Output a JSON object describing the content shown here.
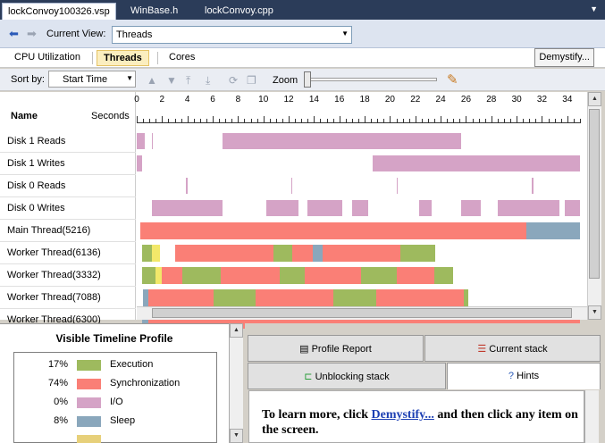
{
  "doc_tabs": [
    "lockConvoy100326.vsp",
    "WinBase.h",
    "lockConvoy.cpp"
  ],
  "current_view": {
    "label": "Current View:",
    "value": "Threads"
  },
  "view_tabs": [
    "CPU Utilization",
    "Threads",
    "Cores"
  ],
  "demystify_label": "Demystify...",
  "toolbar": {
    "sort_label": "Sort by:",
    "sort_value": "Start Time",
    "zoom_label": "Zoom"
  },
  "header": {
    "name": "Name",
    "seconds": "Seconds"
  },
  "ruler_max_seconds": 35,
  "ruler_labels": [
    "0",
    "2",
    "4",
    "6",
    "8",
    "10",
    "12",
    "14",
    "16",
    "18",
    "20",
    "22",
    "24",
    "26",
    "28",
    "30",
    "32",
    "34"
  ],
  "colors": {
    "execution": "#9eba5e",
    "synchronization": "#fa7f76",
    "io": "#d5a3c6",
    "sleep": "#8aa7bc",
    "other": "#f2e86a"
  },
  "rows": [
    {
      "name": "Disk 1 Reads",
      "kind": "io",
      "segments": [
        [
          0,
          0.6
        ],
        [
          1.2,
          1.3
        ],
        [
          6.8,
          25.6
        ]
      ]
    },
    {
      "name": "Disk 1 Writes",
      "kind": "io",
      "segments": [
        [
          0,
          0.4
        ],
        [
          18.6,
          35
        ]
      ]
    },
    {
      "name": "Disk 0 Reads",
      "kind": "io",
      "segments": [
        [
          3.9,
          4.0
        ],
        [
          12.2,
          12.3
        ],
        [
          20.5,
          20.6
        ],
        [
          31.2,
          31.3
        ]
      ]
    },
    {
      "name": "Disk 0 Writes",
      "kind": "io",
      "segments": [
        [
          1.2,
          6.8
        ],
        [
          10.2,
          12.8
        ],
        [
          13.5,
          16.2
        ],
        [
          17.0,
          18.3
        ],
        [
          22.3,
          23.3
        ],
        [
          25.6,
          27.2
        ],
        [
          28.5,
          33.4
        ],
        [
          33.8,
          35
        ]
      ]
    },
    {
      "name": "Main Thread(5216)",
      "kind": "main",
      "segments": [
        [
          "sync",
          0.3,
          30.8
        ],
        [
          "sleep",
          30.8,
          35
        ]
      ]
    },
    {
      "name": "Worker Thread(6136)",
      "kind": "worker",
      "segments": [
        [
          "exec",
          0.4,
          1.2
        ],
        [
          "other",
          1.2,
          1.8
        ],
        [
          "sync",
          3.0,
          10.8
        ],
        [
          "exec",
          10.8,
          12.3
        ],
        [
          "sync",
          12.3,
          13.9
        ],
        [
          "sleep",
          13.9,
          14.7
        ],
        [
          "sync",
          14.7,
          20.8
        ],
        [
          "exec",
          20.8,
          23.6
        ]
      ]
    },
    {
      "name": "Worker Thread(3332)",
      "kind": "worker",
      "segments": [
        [
          "exec",
          0.4,
          1.5
        ],
        [
          "other",
          1.5,
          2.0
        ],
        [
          "sync",
          2.0,
          3.6
        ],
        [
          "exec",
          3.6,
          6.6
        ],
        [
          "sync",
          6.6,
          11.3
        ],
        [
          "exec",
          11.3,
          13.3
        ],
        [
          "sync",
          13.3,
          17.7
        ],
        [
          "exec",
          17.7,
          20.5
        ],
        [
          "sync",
          20.5,
          23.5
        ],
        [
          "exec",
          23.5,
          25.0
        ]
      ]
    },
    {
      "name": "Worker Thread(7088)",
      "kind": "worker",
      "segments": [
        [
          "sleep",
          0.5,
          0.9
        ],
        [
          "sync",
          0.9,
          6.1
        ],
        [
          "exec",
          6.1,
          9.4
        ],
        [
          "sync",
          9.4,
          15.5
        ],
        [
          "exec",
          15.5,
          18.9
        ],
        [
          "sync",
          18.9,
          25.8
        ],
        [
          "exec",
          25.8,
          26.2
        ]
      ]
    },
    {
      "name": "Worker Thread(6300)",
      "kind": "worker",
      "segments": [
        [
          "sleep",
          0.4,
          0.9
        ],
        [
          "sync",
          0.9,
          35
        ]
      ]
    }
  ],
  "profile": {
    "title": "Visible Timeline Profile",
    "items": [
      {
        "pct": "17%",
        "name": "Execution",
        "color": "#9eba5e"
      },
      {
        "pct": "74%",
        "name": "Synchronization",
        "color": "#fa7f76"
      },
      {
        "pct": "0%",
        "name": "I/O",
        "color": "#d5a3c6"
      },
      {
        "pct": "8%",
        "name": "Sleep",
        "color": "#8aa7bc"
      },
      {
        "pct": "",
        "name": "",
        "color": "#e7d07a"
      }
    ]
  },
  "report_tabs": {
    "profile_report": "Profile Report",
    "current_stack": "Current stack",
    "unblocking_stack": "Unblocking stack",
    "hints": "Hints"
  },
  "hint": {
    "before": "To learn more, click ",
    "link": "Demystify...",
    "after": " and then click any item on the screen."
  }
}
